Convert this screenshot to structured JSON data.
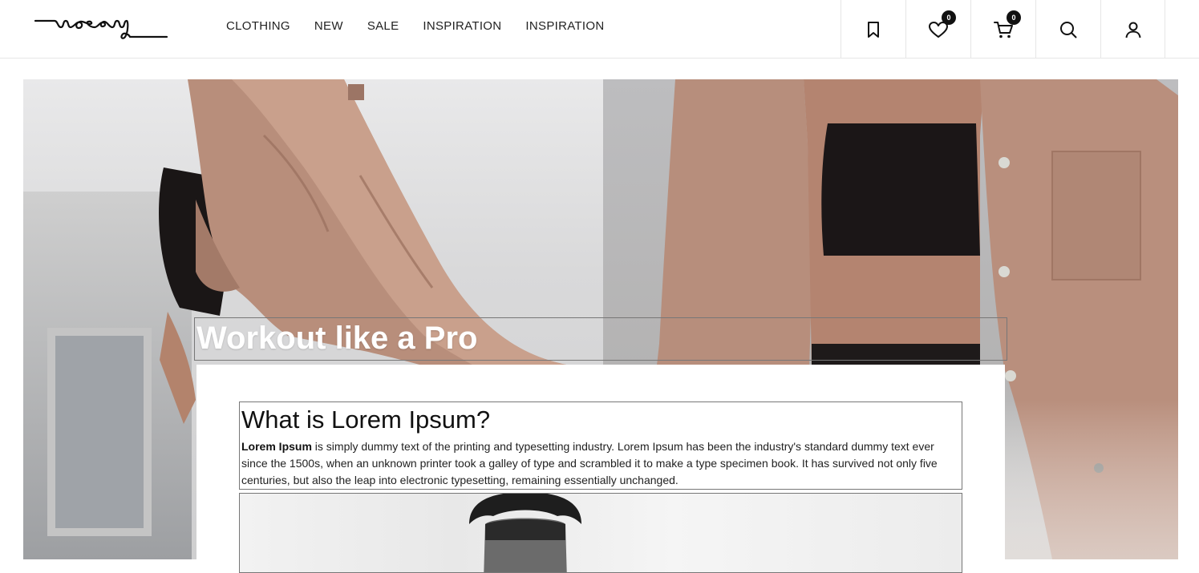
{
  "brand": {
    "logo_text": "mosey"
  },
  "nav": {
    "items": [
      {
        "label": "CLOTHING"
      },
      {
        "label": "NEW"
      },
      {
        "label": "SALE"
      },
      {
        "label": "INSPIRATION"
      },
      {
        "label": "INSPIRATION"
      }
    ]
  },
  "toolbar": {
    "wishlist_count": "0",
    "cart_count": "0",
    "icons": [
      "bookmark-icon",
      "heart-icon",
      "cart-icon",
      "search-icon",
      "user-icon"
    ]
  },
  "hero": {
    "headline": "Workout like a Pro"
  },
  "article": {
    "title": "What is Lorem Ipsum?",
    "lead": "Lorem Ipsum",
    "body": " is simply dummy text of the printing and typesetting industry. Lorem Ipsum has been the industry's standard dummy text ever since the 1500s, when an unknown printer took a galley of type and scrambled it to make a type specimen book. It has survived not only five centuries, but also the leap into electronic typesetting, remaining essentially unchanged."
  },
  "colors": {
    "accent": "#111111",
    "background": "#ffffff",
    "border": "#e6e6e6"
  }
}
